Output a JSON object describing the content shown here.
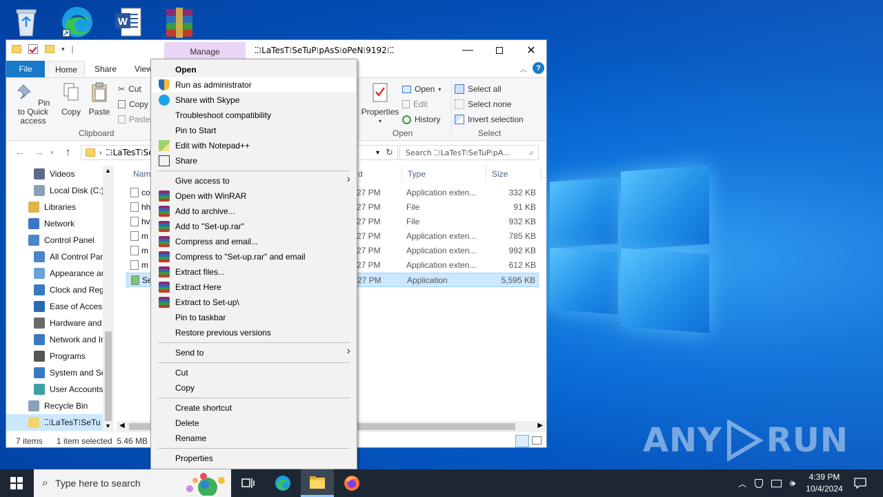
{
  "explorer": {
    "title": "ⵆ⁝LaTesT⁝SeTuP⁝pAsS⁝oPeN⁝9192⁝ⵆ",
    "manage_tab": "Manage",
    "tabs": [
      "File",
      "Home",
      "Share",
      "View"
    ],
    "ribbon": {
      "pin_label": "Pin to Quick access",
      "copy_label": "Copy",
      "paste_label": "Paste",
      "cut_label": "Cut",
      "copy_path_label": "Copy p",
      "paste_shortcut_label": "Paste",
      "clipboard_group": "Clipboard",
      "properties_label": "Properties",
      "open_label": "Open",
      "edit_label": "Edit",
      "history_label": "History",
      "open_group": "Open",
      "select_all": "Select all",
      "select_none": "Select none",
      "invert_selection": "Invert selection",
      "select_group": "Select"
    },
    "address": "ⵆ⁝LaTesT⁝SeTu",
    "search_placeholder": "Search ⵆ⁝LaTesT⁝SeTuP⁝pA...",
    "nav_items": [
      {
        "label": "Videos",
        "icon": "videos-icon"
      },
      {
        "label": "Local Disk (C:)",
        "icon": "drive-icon"
      },
      {
        "label": "Libraries",
        "icon": "libraries-icon"
      },
      {
        "label": "Network",
        "icon": "network-icon"
      },
      {
        "label": "Control Panel",
        "icon": "control-panel-icon"
      },
      {
        "label": "All Control Par",
        "icon": "control-panel-icon"
      },
      {
        "label": "Appearance an",
        "icon": "appearance-icon"
      },
      {
        "label": "Clock and Regi",
        "icon": "clock-icon"
      },
      {
        "label": "Ease of Access",
        "icon": "ease-icon"
      },
      {
        "label": "Hardware and",
        "icon": "hardware-icon"
      },
      {
        "label": "Network and Ir",
        "icon": "network-icon"
      },
      {
        "label": "Programs",
        "icon": "programs-icon"
      },
      {
        "label": "System and Sec",
        "icon": "system-icon"
      },
      {
        "label": "User Accounts",
        "icon": "users-icon"
      },
      {
        "label": "Recycle Bin",
        "icon": "recycle-bin-icon"
      },
      {
        "label": "ⵆ⁝LaTesT⁝SeTu",
        "icon": "folder-icon"
      }
    ],
    "columns": {
      "name": "Name",
      "date": "d",
      "type": "Type",
      "size": "Size"
    },
    "files": [
      {
        "name": "co",
        "date": "27 PM",
        "type": "Application exten...",
        "size": "332 KB"
      },
      {
        "name": "hh",
        "date": "27 PM",
        "type": "File",
        "size": "91 KB"
      },
      {
        "name": "hv",
        "date": "27 PM",
        "type": "File",
        "size": "932 KB"
      },
      {
        "name": "m",
        "date": "27 PM",
        "type": "Application exten...",
        "size": "785 KB"
      },
      {
        "name": "m",
        "date": "27 PM",
        "type": "Application exten...",
        "size": "992 KB"
      },
      {
        "name": "m",
        "date": "27 PM",
        "type": "Application exten...",
        "size": "612 KB"
      },
      {
        "name": "Se",
        "date": "27 PM",
        "type": "Application",
        "size": "5,595 KB"
      }
    ],
    "status": {
      "items": "7 items",
      "selected": "1 item selected  5.46 MB"
    }
  },
  "context_menu": {
    "items": [
      {
        "label": "Open",
        "bold": true
      },
      {
        "label": "Run as administrator",
        "icon": "shield-icon"
      },
      {
        "label": "Share with Skype",
        "icon": "skype-icon"
      },
      {
        "label": "Troubleshoot compatibility"
      },
      {
        "label": "Pin to Start"
      },
      {
        "label": "Edit with Notepad++",
        "icon": "notepad-icon"
      },
      {
        "label": "Share",
        "icon": "share-icon"
      },
      {
        "label": "Give access to",
        "submenu": true
      },
      {
        "label": "Open with WinRAR",
        "icon": "winrar-icon"
      },
      {
        "label": "Add to archive...",
        "icon": "winrar-icon"
      },
      {
        "label": "Add to \"Set-up.rar\"",
        "icon": "winrar-icon"
      },
      {
        "label": "Compress and email...",
        "icon": "winrar-icon"
      },
      {
        "label": "Compress to \"Set-up.rar\" and email",
        "icon": "winrar-icon"
      },
      {
        "label": "Extract files...",
        "icon": "winrar-icon"
      },
      {
        "label": "Extract Here",
        "icon": "winrar-icon"
      },
      {
        "label": "Extract to Set-up\\",
        "icon": "winrar-icon"
      },
      {
        "label": "Pin to taskbar"
      },
      {
        "label": "Restore previous versions"
      },
      {
        "label": "Send to",
        "submenu": true
      },
      {
        "label": "Cut"
      },
      {
        "label": "Copy"
      },
      {
        "label": "Create shortcut"
      },
      {
        "label": "Delete"
      },
      {
        "label": "Rename"
      },
      {
        "label": "Properties"
      }
    ]
  },
  "taskbar": {
    "search_placeholder": "Type here to search",
    "time": "4:39 PM",
    "date": "10/4/2024"
  },
  "watermark": "ANY RUN",
  "colors": {
    "accent": "#1979ca",
    "selection": "#cce8ff",
    "manage_tab": "#e9d5f6"
  }
}
